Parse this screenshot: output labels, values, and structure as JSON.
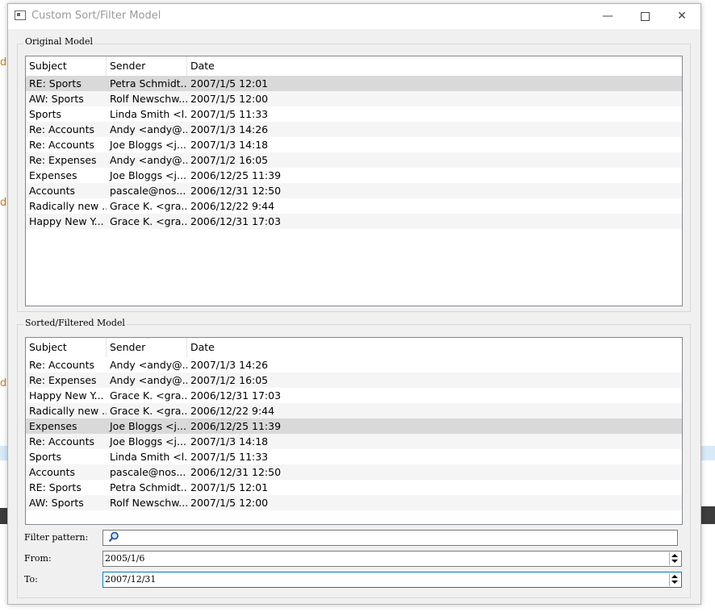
{
  "window": {
    "title": "Custom Sort/Filter Model"
  },
  "original": {
    "group_title": "Original Model",
    "columns": [
      "Subject",
      "Sender",
      "Date"
    ],
    "rows": [
      [
        "RE: Sports",
        "Petra Schmidt...",
        "2007/1/5 12:01"
      ],
      [
        "AW: Sports",
        "Rolf Newschw...",
        "2007/1/5 12:00"
      ],
      [
        "Sports",
        "Linda Smith <l...",
        "2007/1/5 11:33"
      ],
      [
        "Re: Accounts",
        "Andy <andy@...",
        "2007/1/3 14:26"
      ],
      [
        "Re: Accounts",
        "Joe Bloggs <j...",
        "2007/1/3 14:18"
      ],
      [
        "Re: Expenses",
        "Andy <andy@...",
        "2007/1/2 16:05"
      ],
      [
        "Expenses",
        "Joe Bloggs <j...",
        "2006/12/25 11:39"
      ],
      [
        "Accounts",
        "pascale@nos...",
        "2006/12/31 12:50"
      ],
      [
        "Radically new ...",
        "Grace K. <gra...",
        "2006/12/22 9:44"
      ],
      [
        "Happy New Y...",
        "Grace K. <gra...",
        "2006/12/31 17:03"
      ]
    ]
  },
  "sorted": {
    "group_title": "Sorted/Filtered Model",
    "columns": [
      "Subject",
      "Sender",
      "Date"
    ],
    "rows": [
      [
        "Re: Accounts",
        "Andy <andy@...",
        "2007/1/3 14:26"
      ],
      [
        "Re: Expenses",
        "Andy <andy@...",
        "2007/1/2 16:05"
      ],
      [
        "Happy New Y...",
        "Grace K. <gra...",
        "2006/12/31 17:03"
      ],
      [
        "Radically new ...",
        "Grace K. <gra...",
        "2006/12/22 9:44"
      ],
      [
        "Expenses",
        "Joe Bloggs <j...",
        "2006/12/25 11:39"
      ],
      [
        "Re: Accounts",
        "Joe Bloggs <j...",
        "2007/1/3 14:18"
      ],
      [
        "Sports",
        "Linda Smith <l...",
        "2007/1/5 11:33"
      ],
      [
        "Accounts",
        "pascale@nos...",
        "2006/12/31 12:50"
      ],
      [
        "RE: Sports",
        "Petra Schmidt...",
        "2007/1/5 12:01"
      ],
      [
        "AW: Sports",
        "Rolf Newschw...",
        "2007/1/5 12:00"
      ]
    ]
  },
  "filter": {
    "pattern_label": "Filter pattern:",
    "pattern_value": "",
    "from_label": "From:",
    "from_value": "2005/1/6",
    "to_label": "To:",
    "to_value": "2007/12/31"
  },
  "icons": {
    "search": "search-icon",
    "app": "app-window-icon"
  }
}
